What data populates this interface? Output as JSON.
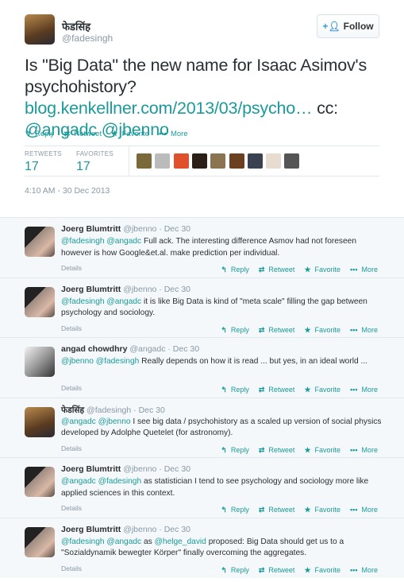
{
  "tweet": {
    "name": "फेडसिंह",
    "handle": "@fadesingh",
    "follow_label": "Follow",
    "text_parts": [
      {
        "t": "Is \"Big Data\" the new name for Isaac Asimov's psychohistory? ",
        "link": false
      },
      {
        "t": "blog.kenkellner.com/2013/03/psycho…",
        "link": true
      },
      {
        "t": " cc: ",
        "link": false
      },
      {
        "t": "@angadc",
        "link": true
      },
      {
        "t": " ",
        "link": false
      },
      {
        "t": "@jbenno",
        "link": true
      }
    ],
    "actions": [
      {
        "icon": "reply-icon",
        "label": "Reply"
      },
      {
        "icon": "retweet-icon",
        "label": "Retweet"
      },
      {
        "icon": "star-icon",
        "label": "Favorite"
      },
      {
        "icon": "more-icon",
        "label": "More"
      }
    ],
    "retweets_label": "RETWEETS",
    "retweets": "17",
    "favorites_label": "FAVORITES",
    "favorites": "17",
    "favoriters_count": 9,
    "timestamp": "4:10 AM - 30 Dec 2013"
  },
  "colors": {
    "accent": "#1b9a9a",
    "background": "#f5f8fa",
    "muted": "#8899a6"
  },
  "details_label": "Details",
  "replies": [
    {
      "name": "Joerg Blumtritt",
      "handle": "@jbenno",
      "date": "· Dec 30",
      "avatar": "av2",
      "parts": [
        {
          "t": "@fadesingh",
          "link": true
        },
        {
          "t": " ",
          "link": false
        },
        {
          "t": "@angadc",
          "link": true
        },
        {
          "t": " Full ack. The interesting difference Asmov had not foreseen however is how Google&et.al. make prediction per individual.",
          "link": false
        }
      ]
    },
    {
      "name": "Joerg Blumtritt",
      "handle": "@jbenno",
      "date": "· Dec 30",
      "avatar": "av2",
      "parts": [
        {
          "t": "@fadesingh",
          "link": true
        },
        {
          "t": " ",
          "link": false
        },
        {
          "t": "@angadc",
          "link": true
        },
        {
          "t": " it is like Big Data is kind of \"meta scale\" filling the gap between psychology and sociology.",
          "link": false
        }
      ]
    },
    {
      "name": "angad chowdhry",
      "handle": "@angadc",
      "date": "· Dec 30",
      "avatar": "av3",
      "parts": [
        {
          "t": "@jbenno",
          "link": true
        },
        {
          "t": " ",
          "link": false
        },
        {
          "t": "@fadesingh",
          "link": true
        },
        {
          "t": " Really depends on how it is read ... but yes, in an ideal world ...",
          "link": false
        }
      ]
    },
    {
      "name": "फेडसिंह",
      "handle": "@fadesingh",
      "date": "· Dec 30",
      "avatar": "av1",
      "parts": [
        {
          "t": "@angadc",
          "link": true
        },
        {
          "t": " ",
          "link": false
        },
        {
          "t": "@jbenno",
          "link": true
        },
        {
          "t": " I see big data / psychohistory as a scaled up version of social physics developed by Adolphe Quetelet (for astronomy).",
          "link": false
        }
      ]
    },
    {
      "name": "Joerg Blumtritt",
      "handle": "@jbenno",
      "date": "· Dec 30",
      "avatar": "av2",
      "parts": [
        {
          "t": "@angadc",
          "link": true
        },
        {
          "t": " ",
          "link": false
        },
        {
          "t": "@fadesingh",
          "link": true
        },
        {
          "t": " as statistician I tend to see psychology and sociology more like applied sciences in this context.",
          "link": false
        }
      ]
    },
    {
      "name": "Joerg Blumtritt",
      "handle": "@jbenno",
      "date": "· Dec 30",
      "avatar": "av2",
      "parts": [
        {
          "t": "@fadesingh",
          "link": true
        },
        {
          "t": " ",
          "link": false
        },
        {
          "t": "@angadc",
          "link": true
        },
        {
          "t": " as ",
          "link": false
        },
        {
          "t": "@helge_david",
          "link": true
        },
        {
          "t": " proposed: Big Data should get us to a \"Sozialdynamik bewegter Körper\" finally overcoming the aggregates.",
          "link": false
        }
      ]
    }
  ]
}
